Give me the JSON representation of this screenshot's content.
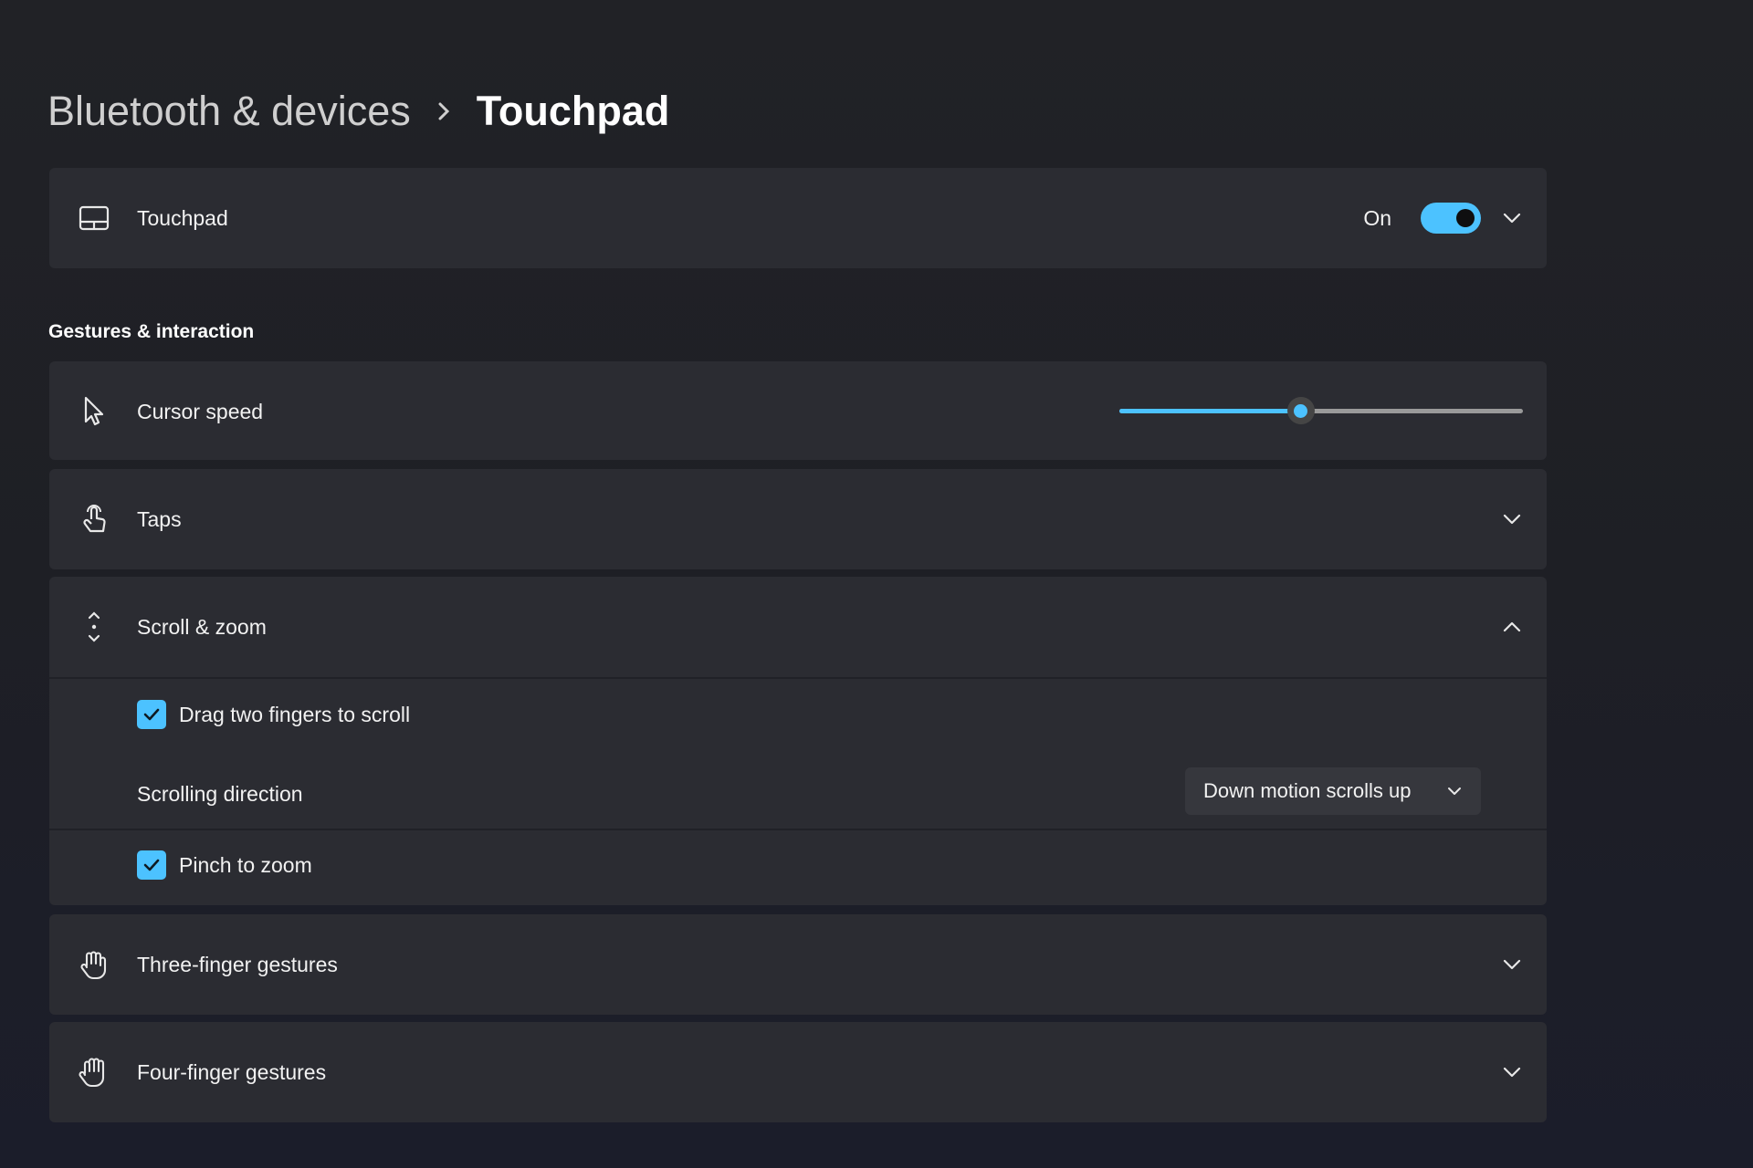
{
  "breadcrumb": {
    "parent": "Bluetooth & devices",
    "separator": "›",
    "current": "Touchpad"
  },
  "touchpad_card": {
    "label": "Touchpad",
    "icon": "touchpad-icon",
    "toggle_text": "On",
    "toggle_on": true
  },
  "section": {
    "title": "Gestures & interaction"
  },
  "cursor_speed": {
    "label": "Cursor speed",
    "icon": "cursor-icon",
    "value_fraction": 0.45
  },
  "taps": {
    "label": "Taps",
    "icon": "tap-icon"
  },
  "scroll_zoom": {
    "label": "Scroll & zoom",
    "icon": "scroll-icon",
    "expanded": true,
    "drag_two_fingers": {
      "label": "Drag two fingers to scroll",
      "checked": true
    },
    "scrolling_direction": {
      "label": "Scrolling direction",
      "selected": "Down motion scrolls up"
    },
    "pinch_to_zoom": {
      "label": "Pinch to zoom",
      "checked": true
    }
  },
  "three_finger": {
    "label": "Three-finger gestures",
    "icon": "three-finger-hand-icon"
  },
  "four_finger": {
    "label": "Four-finger gestures",
    "icon": "four-finger-hand-icon"
  },
  "colors": {
    "accent": "#4cc2ff",
    "card": "#2b2c32",
    "background": "#202126"
  }
}
